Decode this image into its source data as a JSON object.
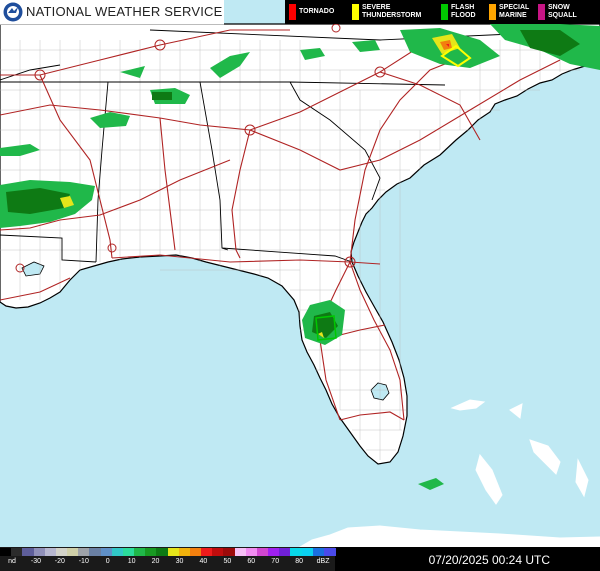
{
  "header": {
    "agency": "NATIONAL WEATHER SERVICE",
    "logo_icon": "noaa-nws-logo-icon"
  },
  "legend": [
    {
      "line1": "TORNADO",
      "line2": "",
      "color": "#ff0000"
    },
    {
      "line1": "SEVERE",
      "line2": "THUNDERSTORM",
      "color": "#ffff00"
    },
    {
      "line1": "FLASH",
      "line2": "FLOOD",
      "color": "#00c800"
    },
    {
      "line1": "SPECIAL",
      "line2": "MARINE",
      "color": "#ffa500"
    },
    {
      "line1": "SNOW",
      "line2": "SQUALL",
      "color": "#c71585"
    }
  ],
  "scale": {
    "labels": [
      "nd",
      "-30",
      "-20",
      "-10",
      "0",
      "10",
      "20",
      "30",
      "40",
      "50",
      "60",
      "70",
      "80",
      "dBZ"
    ],
    "colors": [
      "#000000",
      "#2b2b2b",
      "#5e5e9a",
      "#8f8fb8",
      "#b7b7cf",
      "#d2d2c8",
      "#cfcfa8",
      "#9ea2a8",
      "#6a80a4",
      "#5f90c8",
      "#31c7c7",
      "#2bdc9b",
      "#20b84a",
      "#189a22",
      "#0e7a14",
      "#e5e51a",
      "#f0b20c",
      "#f27f0e",
      "#ef1b1b",
      "#c00d0d",
      "#9c0a0a",
      "#f6bff6",
      "#f08bf0",
      "#d146d1",
      "#a020f0",
      "#7020d8",
      "#08d7e8",
      "#0ad0f0",
      "#1a6fe0",
      "#4a4aea"
    ]
  },
  "footer": {
    "timestamp": "07/20/2025 00:24 UTC"
  },
  "map": {
    "water_color": "#bfe9f3",
    "land_color": "#ffffff",
    "highway_color": "#b02424",
    "county_color": "#b3b3b3",
    "state_line_color": "#000000",
    "warning_box_color": "#ffff00"
  }
}
